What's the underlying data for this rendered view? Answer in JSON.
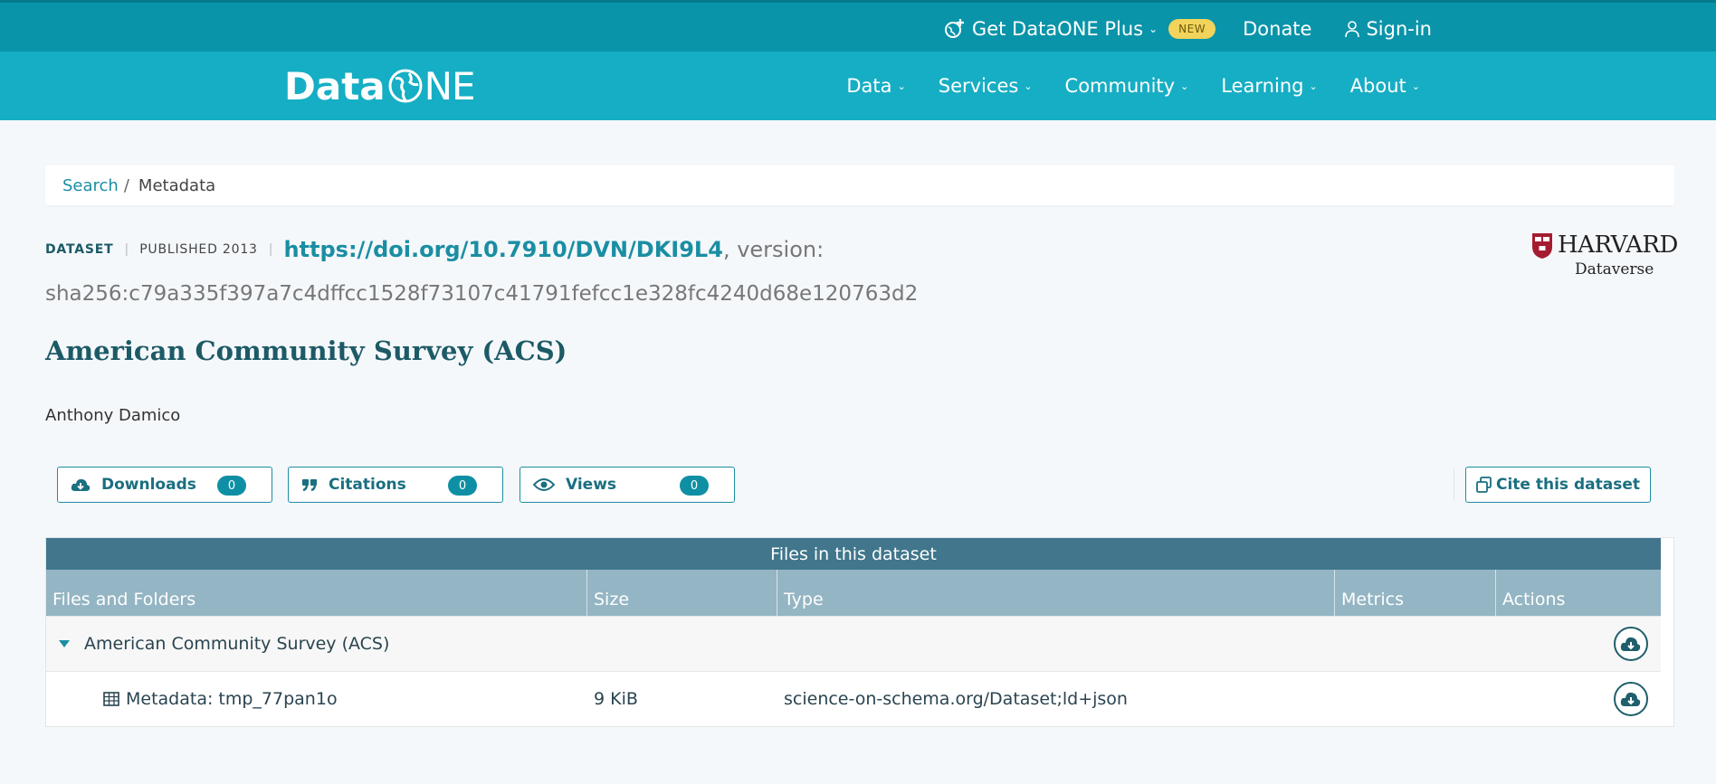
{
  "topbar": {
    "plus_label": "Get DataONE Plus",
    "new_badge": "NEW",
    "donate": "Donate",
    "signin": "Sign-in"
  },
  "nav": {
    "logo_left": "Data",
    "logo_right": "NE",
    "items": [
      "Data",
      "Services",
      "Community",
      "Learning",
      "About"
    ]
  },
  "breadcrumb": {
    "search": "Search",
    "sep": "/",
    "current": "Metadata"
  },
  "dataset": {
    "type": "DATASET",
    "published": "PUBLISHED 2013",
    "doi": "https://doi.org/10.7910/DVN/DKI9L4",
    "version_label": ", version:",
    "version": "sha256:c79a335f397a7c4dffcc1528f73107c41791fefcc1e328fc4240d68e120763d2",
    "title": "American Community Survey (ACS)",
    "author": "Anthony Damico",
    "repository": {
      "name": "HARVARD",
      "sub": "Dataverse"
    }
  },
  "metrics": {
    "downloads": {
      "label": "Downloads",
      "count": "0"
    },
    "citations": {
      "label": "Citations",
      "count": "0"
    },
    "views": {
      "label": "Views",
      "count": "0"
    },
    "cite_label": "Cite this dataset"
  },
  "files": {
    "title": "Files in this dataset",
    "columns": [
      "Files and Folders",
      "Size",
      "Type",
      "Metrics",
      "Actions"
    ],
    "folder": {
      "name": "American Community Survey (ACS)"
    },
    "items": [
      {
        "name": "Metadata: tmp_77pan1o",
        "size": "9 KiB",
        "type": "science-on-schema.org/Dataset;ld+json"
      }
    ]
  },
  "colors": {
    "topbar": "#0a94a9",
    "nav": "#16aec4",
    "accent": "#1a8ea3",
    "table_header": "#41768c"
  }
}
